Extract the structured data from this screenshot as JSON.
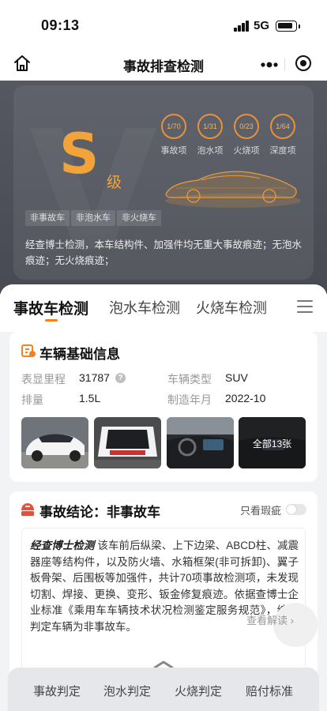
{
  "status_bar": {
    "time": "09:13",
    "network": "5G"
  },
  "nav": {
    "title": "事故排查检测"
  },
  "hero": {
    "grade_letter": "S",
    "grade_suffix": "级",
    "stats": [
      {
        "value": "1/70",
        "label": "事故项"
      },
      {
        "value": "1/31",
        "label": "泡水项"
      },
      {
        "value": "0/23",
        "label": "火烧项"
      },
      {
        "value": "1/64",
        "label": "深度项"
      }
    ],
    "tags": [
      "非事故车",
      "非泡水车",
      "非火烧车"
    ],
    "description": "经查博士检测，本车结构件、加强件均无重大事故痕迹；无泡水痕迹；无火烧痕迹；"
  },
  "tabs": [
    "事故车检测",
    "泡水车检测",
    "火烧车检测"
  ],
  "basic_info": {
    "title": "车辆基础信息",
    "fields": [
      {
        "label": "表显里程",
        "value": "31787"
      },
      {
        "label": "车辆类型",
        "value": "SUV"
      },
      {
        "label": "排量",
        "value": "1.5L"
      },
      {
        "label": "制造年月",
        "value": "2022-10"
      }
    ],
    "photos_label": "全部13张"
  },
  "conclusion": {
    "title": "事故结论：非事故车",
    "toggle_label": "只看瑕疵",
    "brand": "经查博士检测",
    "text": "该车前后纵梁、上下边梁、ABCD柱、减震器座等结构件，以及防火墙、水箱框架(非可拆卸)、翼子板骨架、后围板等加强件，共计70项事故检测项，未发现切割、焊接、更换、变形、钣金修复痕迹。依据查博士企业标准《乘用车车辆技术状况检测鉴定服务规范》，综合判定车辆为非事故车。",
    "more_link": "查看解读 ›"
  },
  "bottom_nav": [
    "事故判定",
    "泡水判定",
    "火烧判定",
    "赔付标准"
  ],
  "colors": {
    "accent": "#f2821f",
    "grade": "#f2a33a",
    "hero_bg": "#4f525a"
  }
}
